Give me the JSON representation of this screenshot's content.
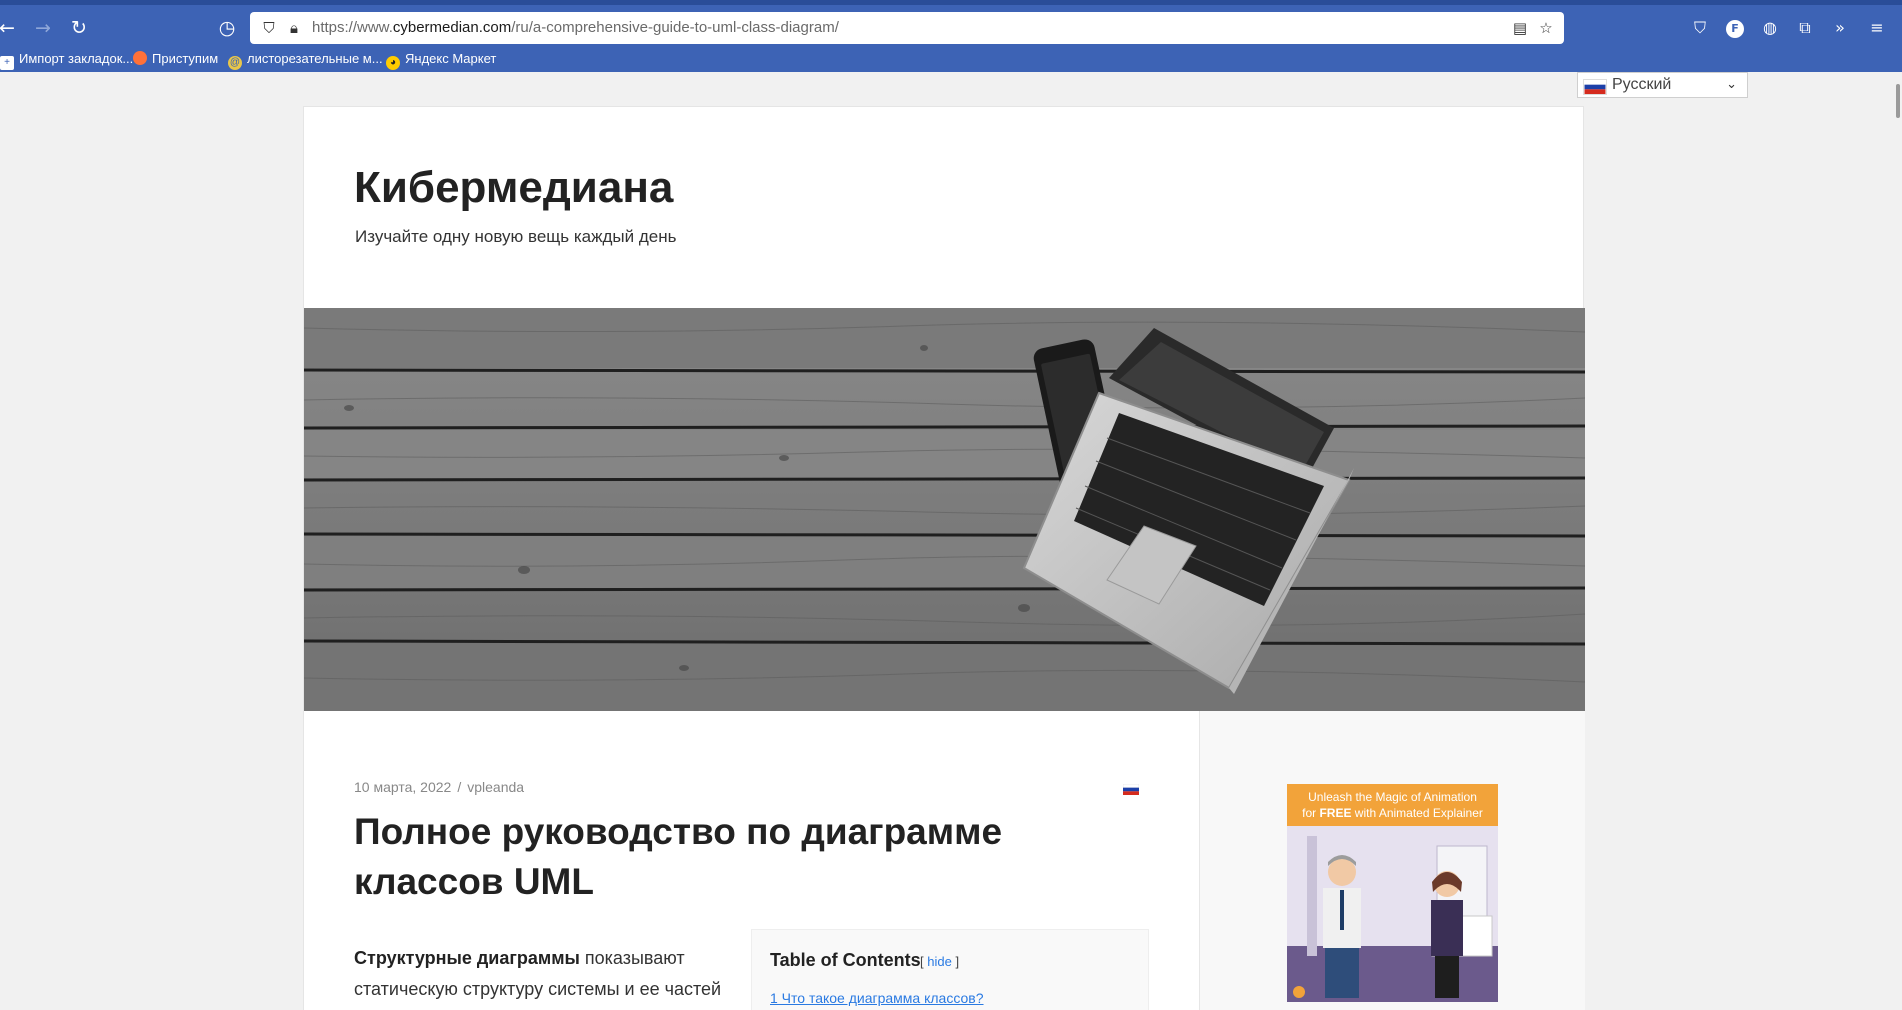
{
  "browser": {
    "url_prefix": "https://www.",
    "url_domain": "cybermedian.com",
    "url_path": "/ru/a-comprehensive-guide-to-uml-class-diagram/",
    "bookmarks": [
      {
        "label": "Импорт закладок..."
      },
      {
        "label": "Приступим"
      },
      {
        "label": "листорезательные м..."
      },
      {
        "label": "Яндекс Маркет"
      }
    ],
    "profile_initial": "F"
  },
  "language_selector": {
    "selected": "Русский"
  },
  "site": {
    "title": "Кибермедиана",
    "description": "Изучайте одну новую вещь каждый день"
  },
  "post": {
    "date": "10 марта, 2022",
    "separator": "/",
    "author": "vpleanda",
    "title": "Полное руководство по диаграмме классов UML",
    "intro_bold": "Структурные диаграммы",
    "intro_rest": " показывают статическую структуру системы и ее частей"
  },
  "toc": {
    "title": "Table of Contents",
    "bracket_open": "[",
    "toggle": "hide",
    "bracket_close": "]",
    "items": [
      {
        "label": "1 Что такое диаграмма классов?"
      }
    ]
  },
  "sidebar": {
    "ad_line1": "Unleash the Magic of Animation",
    "ad_line2_pre": "for ",
    "ad_line2_bold": "FREE",
    "ad_line2_post": " with Animated Explainer"
  },
  "colors": {
    "chrome": "#3d63b5",
    "link": "#2a7ae2"
  }
}
